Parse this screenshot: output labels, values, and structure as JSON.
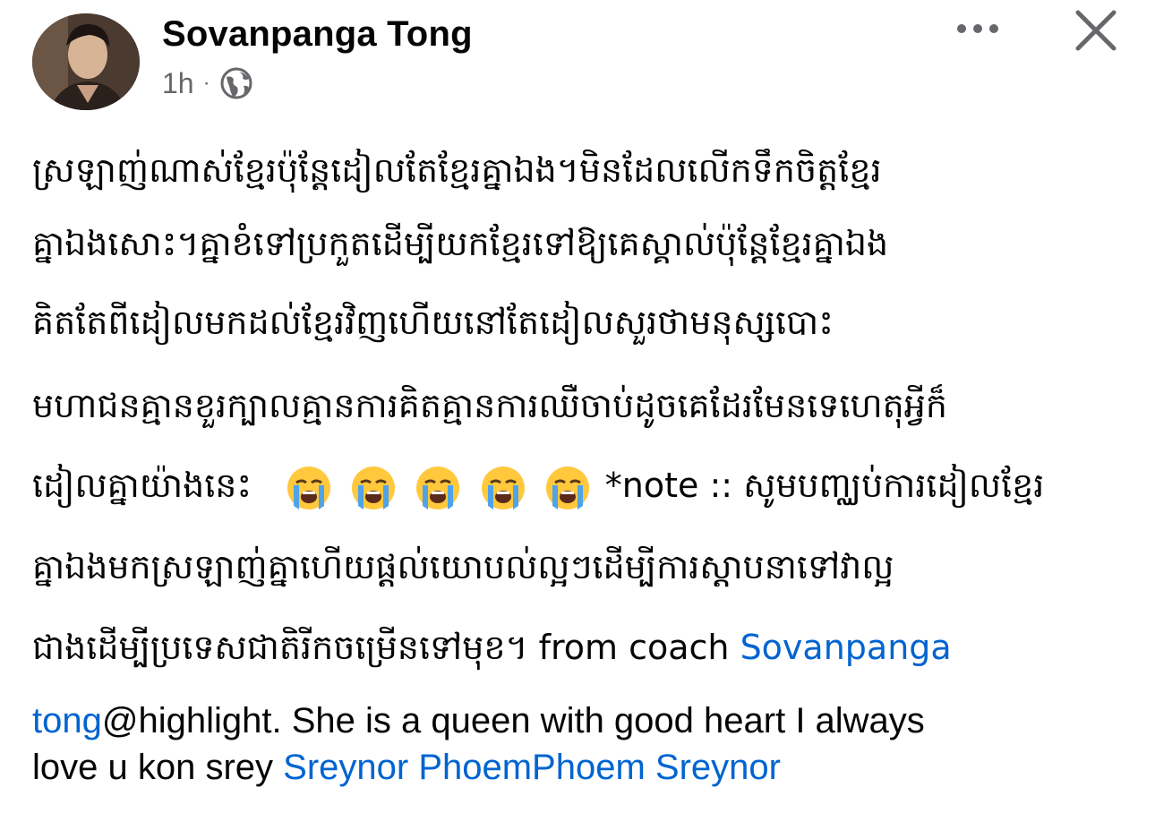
{
  "post": {
    "author": "Sovanpanga Tong",
    "time": "1h",
    "separator": "·",
    "privacy_icon": "globe-icon",
    "more_icon": "more-dots-icon",
    "close_icon": "close-icon",
    "lines": {
      "l1": "ស្រឡាញ់ណាស់ខ្មែរប៉ុន្តែដៀលតែខ្មែរគ្នាឯង។មិនដែលលើកទឹកចិត្តខ្មែរ",
      "l2": "គ្នាឯងសោះ។គ្នាខំទៅប្រកួតដើម្បីយកខ្មែរទៅឱ្យគេស្គាល់ប៉ុន្តែខ្មែរគ្នាឯង",
      "l3": "គិតតែពីដៀលមកដល់ខ្មែរវិញហើយនៅតែដៀលសួរថាមនុស្សបោះ",
      "l4": "មហាជនគ្មានខួរក្បាលគ្មានការគិតគ្មានការឈឺចាប់ដូចគេដែរមែនទេហេតុអ្វីក៏",
      "l5_prefix": "ដៀលគ្នាយ៉ាងនេះ",
      "l5_note": "*note :: សូមបញ្ឈប់ការដៀលខ្មែរ",
      "l6": "គ្នាឯងមកស្រឡាញ់គ្នាហើយផ្តល់យោបល់ល្អៗដើម្បីការស្ដាបនាទៅវាល្អ",
      "l7_prefix": "ជាងដើម្បីប្រទេសជាតិរីកចម្រើនទៅមុខ។ from coach ",
      "l7_link": "Sovanpanga",
      "l8_link": "tong",
      "l8_text": "@highlight. She is a queen with good heart I always",
      "l9_text": "love u kon srey ",
      "l9_link": "Sreynor PhoemPhoem Sreynor"
    },
    "emoji_name": "loudly-crying-face-emoji",
    "emoji_count": 5
  },
  "colors": {
    "text": "#050505",
    "secondary": "#65676b",
    "link": "#0064d1",
    "emoji_face": "#ffc83d",
    "emoji_tears": "#4fa3e8"
  }
}
